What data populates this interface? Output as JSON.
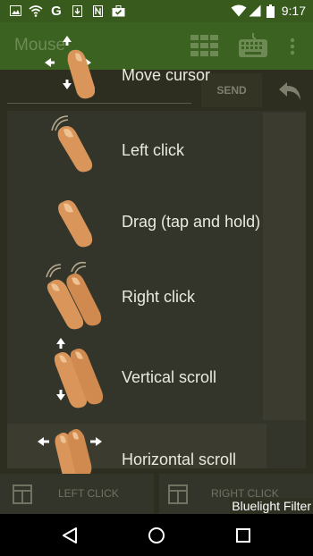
{
  "status_bar": {
    "time": "9:17",
    "left_icons": [
      "image-icon",
      "wifi-calling-icon",
      "google-icon",
      "download-icon",
      "nfc-icon",
      "briefcase-check-icon"
    ],
    "right_icons": [
      "wifi-icon",
      "signal-icon",
      "battery-icon"
    ]
  },
  "app_bar": {
    "title": "Mouse",
    "icons": [
      "keypad-grid-icon",
      "keyboard-icon",
      "overflow-menu-icon"
    ]
  },
  "input": {
    "send_label": "SEND",
    "back_icon": "undo-arrow-icon"
  },
  "gestures": [
    {
      "label": "Move cursor",
      "icon": "one-finger-move-icon"
    },
    {
      "label": "Left click",
      "icon": "one-finger-tap-icon"
    },
    {
      "label": "Drag (tap and hold)",
      "icon": "one-finger-hold-icon"
    },
    {
      "label": "Right click",
      "icon": "two-finger-tap-icon"
    },
    {
      "label": "Vertical scroll",
      "icon": "two-finger-vertical-scroll-icon"
    },
    {
      "label": "Horizontal scroll",
      "icon": "two-finger-horizontal-scroll-icon"
    }
  ],
  "bottom_buttons": {
    "left_click": "LEFT CLICK",
    "right_click": "RIGHT CLICK"
  },
  "overlay": {
    "bluelight_filter": "Bluelight Filter"
  },
  "nav_bar": {
    "icons": [
      "back-triangle-icon",
      "home-circle-icon",
      "recents-square-icon"
    ]
  },
  "colors": {
    "status_bar": "#385a1c",
    "app_bar": "#3b6220",
    "content_background": "#2d2e20",
    "finger_skin": "#d9955a"
  }
}
